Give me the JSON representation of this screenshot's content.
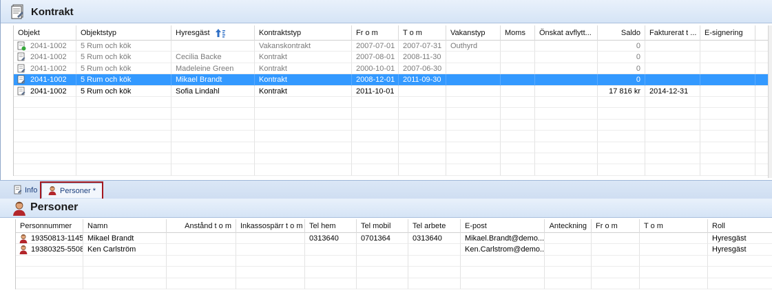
{
  "kontrakt": {
    "title": "Kontrakt",
    "columns": [
      "Objekt",
      "Objektstyp",
      "Hyresgäst",
      "Kontraktstyp",
      "Fr o m",
      "T o m",
      "Vakanstyp",
      "Moms",
      "Önskat avflytt...",
      "Saldo",
      "Fakturerat t ...",
      "E-signering"
    ],
    "sort_icon": "sort-ascending-icon",
    "rows": [
      {
        "objekt": "2041-1002",
        "objektstyp": "5 Rum och kök",
        "hyresgast": "",
        "kontraktstyp": "Vakanskontrakt",
        "from": "2007-07-01",
        "tom": "2007-07-31",
        "vakanstyp": "Outhyrd",
        "moms": "",
        "onskat": "",
        "saldo": "0",
        "fakturerat": "",
        "esign": "",
        "state": "dim"
      },
      {
        "objekt": "2041-1002",
        "objektstyp": "5 Rum och kök",
        "hyresgast": "Cecilia Backe",
        "kontraktstyp": "Kontrakt",
        "from": "2007-08-01",
        "tom": "2008-11-30",
        "vakanstyp": "",
        "moms": "",
        "onskat": "",
        "saldo": "0",
        "fakturerat": "",
        "esign": "",
        "state": "dim"
      },
      {
        "objekt": "2041-1002",
        "objektstyp": "5 Rum och kök",
        "hyresgast": "Madeleine Green",
        "kontraktstyp": "Kontrakt",
        "from": "2000-10-01",
        "tom": "2007-06-30",
        "vakanstyp": "",
        "moms": "",
        "onskat": "",
        "saldo": "0",
        "fakturerat": "",
        "esign": "",
        "state": "dim"
      },
      {
        "objekt": "2041-1002",
        "objektstyp": "5 Rum och kök",
        "hyresgast": "Mikael Brandt",
        "kontraktstyp": "Kontrakt",
        "from": "2008-12-01",
        "tom": "2011-09-30",
        "vakanstyp": "",
        "moms": "",
        "onskat": "",
        "saldo": "0",
        "fakturerat": "",
        "esign": "",
        "state": "sel"
      },
      {
        "objekt": "2041-1002",
        "objektstyp": "5 Rum och kök",
        "hyresgast": "Sofia Lindahl",
        "kontraktstyp": "Kontrakt",
        "from": "2011-10-01",
        "tom": "",
        "vakanstyp": "",
        "moms": "",
        "onskat": "",
        "saldo": "17 816 kr",
        "fakturerat": "2014-12-31",
        "esign": "",
        "state": "normal"
      }
    ]
  },
  "tabs": {
    "info_label": "Info",
    "personer_label": "Personer *"
  },
  "personer": {
    "title": "Personer",
    "columns": [
      "Personnummer",
      "Namn",
      "Anstånd t o m",
      "Inkassospärr t o m",
      "Tel hem",
      "Tel mobil",
      "Tel arbete",
      "E-post",
      "Anteckning",
      "Fr o m",
      "T o m",
      "Roll"
    ],
    "rows": [
      {
        "pnr": "19350813-1145",
        "namn": "Mikael Brandt",
        "anstand": "",
        "inkasso": "",
        "telhem": "0313640",
        "telmobil": "0701364",
        "telarbete": "0313640",
        "epost": "Mikael.Brandt@demo...",
        "anteckning": "",
        "from": "",
        "tom": "",
        "roll": "Hyresgäst"
      },
      {
        "pnr": "19380325-5508",
        "namn": "Ken Carlström",
        "anstand": "",
        "inkasso": "",
        "telhem": "",
        "telmobil": "",
        "telarbete": "",
        "epost": "Ken.Carlstrom@demo...",
        "anteckning": "",
        "from": "",
        "tom": "",
        "roll": "Hyresgäst"
      }
    ]
  },
  "colors": {
    "selection": "#3399ff",
    "header_bg": "#d5e4f6",
    "tab_highlight": "#a4171f"
  }
}
